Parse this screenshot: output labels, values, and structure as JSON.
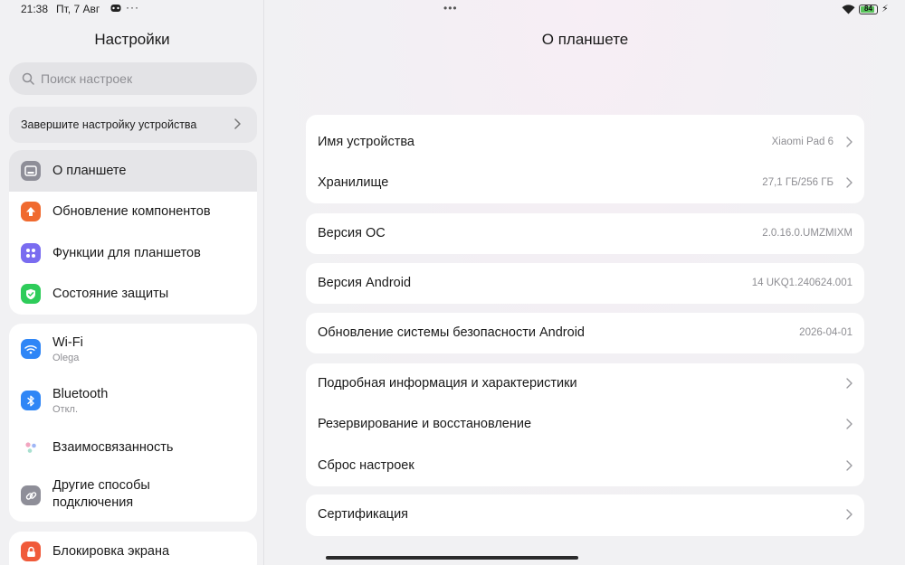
{
  "status_bar": {
    "time": "21:38",
    "date": "Пт, 7 Авг",
    "more": "···",
    "center_dots": "•••",
    "battery_level": "84",
    "battery_percent": 0.84
  },
  "left_pane": {
    "title": "Настройки",
    "search_placeholder": "Поиск настроек",
    "finish_setup": "Завершите настройку устройства",
    "group1": [
      {
        "label": "О планшете",
        "icon": "tablet-icon",
        "color": "#8e8e98",
        "active": true
      },
      {
        "label": "Обновление компонентов",
        "icon": "arrow-up-icon",
        "color": "#f06a2f"
      },
      {
        "label": "Функции для планшетов",
        "icon": "grid-icon",
        "color": "#7a6cf0"
      },
      {
        "label": "Состояние защиты",
        "icon": "shield-icon",
        "color": "#2ecc5a"
      }
    ],
    "group2": [
      {
        "label": "Wi-Fi",
        "sub": "Olega",
        "icon": "wifi-icon",
        "color": "#2f86f6"
      },
      {
        "label": "Bluetooth",
        "sub": "Откл.",
        "icon": "bluetooth-icon",
        "color": "#2f86f6"
      },
      {
        "label": "Взаимосвязанность",
        "icon": "connectivity-icon",
        "color": "#ffffff"
      },
      {
        "label_line1": "Другие способы",
        "label_line2": "подключения",
        "icon": "link-icon",
        "color": "#8e8e98"
      }
    ],
    "group3": [
      {
        "label": "Блокировка экрана",
        "icon": "lock-icon",
        "color": "#f05a3a"
      }
    ]
  },
  "right_pane": {
    "title": "О планшете",
    "device_name_label": "Имя устройства",
    "device_name_value": "Xiaomi Pad 6",
    "storage_label": "Хранилище",
    "storage_value": "27,1 ГБ/256 ГБ",
    "os_version_label": "Версия ОС",
    "os_version_value": "2.0.16.0.UMZMIXM",
    "android_version_label": "Версия Android",
    "android_version_value": "14 UKQ1.240624.001",
    "security_update_label": "Обновление системы безопасности Android",
    "security_update_value": "2026-04-01",
    "detailed_info_label": "Подробная информация и характеристики",
    "backup_label": "Резервирование и восстановление",
    "reset_label": "Сброс настроек",
    "certification_label": "Сертификация"
  }
}
